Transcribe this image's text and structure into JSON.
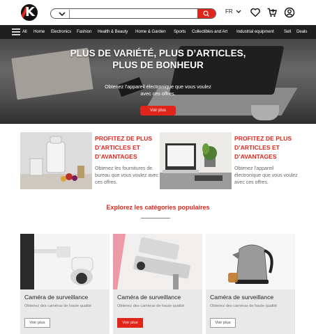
{
  "header": {
    "search": {
      "placeholder": ""
    },
    "language": "FR",
    "icons": [
      "logo-icon",
      "chevron-down-icon",
      "search-icon",
      "heart-icon",
      "cart-icon",
      "user-icon"
    ]
  },
  "nav": {
    "all_label": "All",
    "items": [
      "Home",
      "Electronics",
      "Fashion",
      "Health & Beauty",
      "Home & Garden",
      "Sports",
      "Collectibles and Art",
      "Industrial equipment",
      "Sell",
      "Deals"
    ]
  },
  "hero": {
    "title": "PLUS DE VARIÉTÉ, PLUS D’ARTICLES, PLUS DE BONHEUR",
    "subtitle": "Obtenez l'appareil électronique que vous voulez avec ces offres.",
    "button": "Voir plus"
  },
  "promos": [
    {
      "title": "PROFITEZ DE PLUS D’ARTICLES ET D’AVANTAGES",
      "text": "Obtenez les fournitures de bureau que vous voulez avec ces offres."
    },
    {
      "title": "PROFITEZ DE PLUS D’ARTICLES ET D’AVANTAGES",
      "text": "Obtenez l'appareil électronique que vous voulez avec ces offres."
    }
  ],
  "categories": {
    "title": "Explorez les catégories populaires",
    "cards": [
      {
        "title": "Caméra de surveillance",
        "subtitle": "Obtenez des caméras de haute qualité",
        "button": "Voir plus",
        "highlighted": false
      },
      {
        "title": "Caméra de surveillance",
        "subtitle": "Obtenez des caméras de haute qualité",
        "button": "Voir plus",
        "highlighted": true
      },
      {
        "title": "Caméra de surveillance",
        "subtitle": "Obtenez des caméras de haute qualité",
        "button": "Voir plus",
        "highlighted": false
      }
    ]
  },
  "colors": {
    "accent": "#e0251b",
    "nav_bg": "#1f1f1f",
    "card_bg": "#e9e9e9"
  }
}
